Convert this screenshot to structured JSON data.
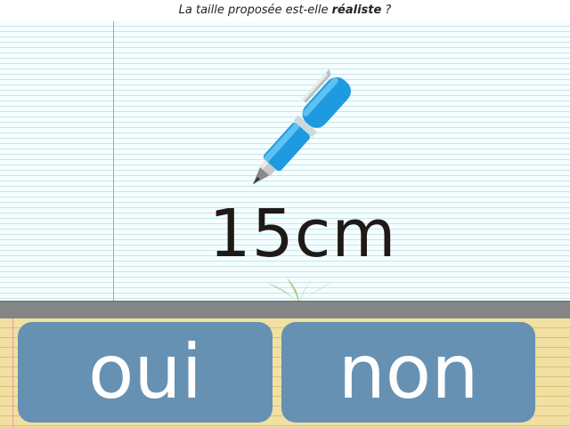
{
  "question": {
    "prefix": "La taille proposée est-elle ",
    "emphasis": "réaliste",
    "suffix": " ?"
  },
  "item": {
    "icon": "pen-icon",
    "size_label": "15cm"
  },
  "answers": {
    "yes_label": "oui",
    "no_label": "non"
  },
  "colors": {
    "button": "#6691b3",
    "pen_body": "#1e9be0",
    "tray": "#f1e0a2",
    "shelf": "#858585",
    "margin_line": "#e98a8a"
  }
}
